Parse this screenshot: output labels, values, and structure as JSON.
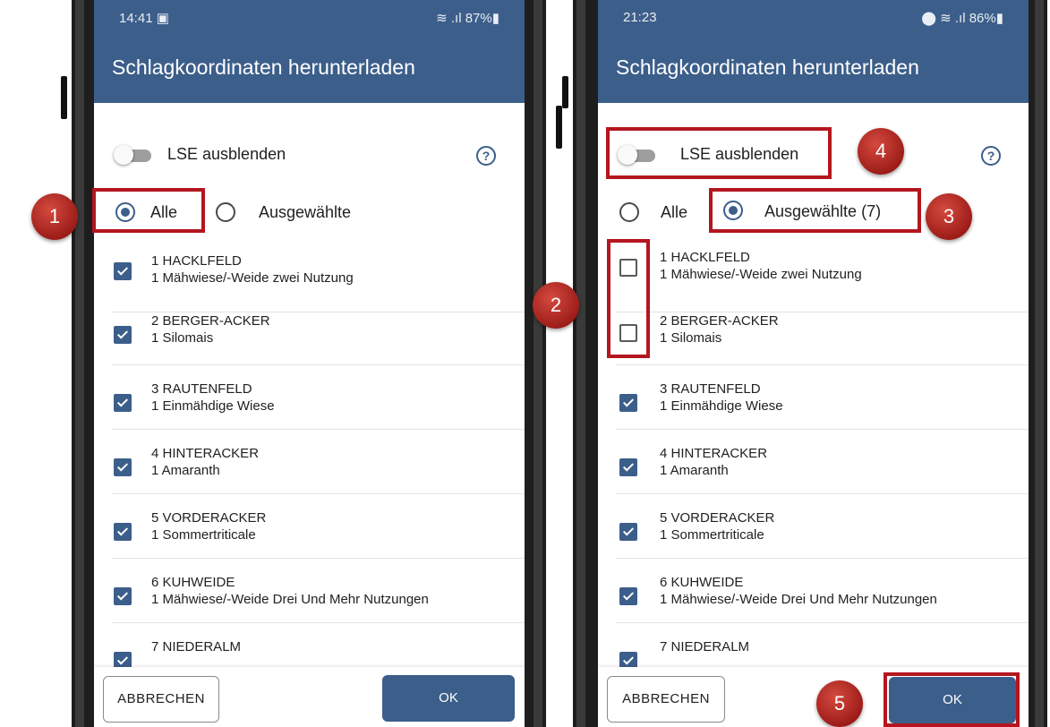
{
  "left_phone": {
    "status": {
      "time": "14:41 ▣",
      "indicators": "≋ .ıl 87%▮"
    },
    "title": "Schlagkoordinaten herunterladen",
    "toggle_label": "LSE ausblenden",
    "help_glyph": "?",
    "radio_all": "Alle",
    "radio_selected": "Ausgewählte",
    "items": [
      {
        "name": "1 HACKLFELD",
        "crop": "1 Mähwiese/-Weide zwei Nutzung"
      },
      {
        "name": "2 BERGER-ACKER",
        "crop": "1 Silomais"
      },
      {
        "name": "3 RAUTENFELD",
        "crop": "1 Einmähdige Wiese"
      },
      {
        "name": "4 HINTERACKER",
        "crop": "1 Amaranth"
      },
      {
        "name": "5 VORDERACKER",
        "crop": "1 Sommertriticale"
      },
      {
        "name": "6 KUHWEIDE",
        "crop": "1 Mähwiese/-Weide Drei Und Mehr Nutzungen"
      },
      {
        "name": "7 NIEDERALM",
        "crop": ""
      }
    ],
    "cancel": "ABBRECHEN",
    "ok": "OK"
  },
  "right_phone": {
    "status": {
      "time": "21:23",
      "indicators": "⬤ ≋ .ıl 86%▮"
    },
    "title": "Schlagkoordinaten herunterladen",
    "toggle_label": "LSE ausblenden",
    "help_glyph": "?",
    "radio_all": "Alle",
    "radio_selected": "Ausgewählte (7)",
    "items": [
      {
        "name": "1 HACKLFELD",
        "crop": "1 Mähwiese/-Weide zwei Nutzung"
      },
      {
        "name": "2 BERGER-ACKER",
        "crop": "1 Silomais"
      },
      {
        "name": "3 RAUTENFELD",
        "crop": "1 Einmähdige Wiese"
      },
      {
        "name": "4 HINTERACKER",
        "crop": "1 Amaranth"
      },
      {
        "name": "5 VORDERACKER",
        "crop": "1 Sommertriticale"
      },
      {
        "name": "6 KUHWEIDE",
        "crop": "1 Mähwiese/-Weide Drei Und Mehr Nutzungen"
      },
      {
        "name": "7 NIEDERALM",
        "crop": ""
      }
    ],
    "cancel": "ABBRECHEN",
    "ok": "OK"
  },
  "badges": {
    "b1": "1",
    "b2": "2",
    "b3": "3",
    "b4": "4",
    "b5": "5"
  },
  "state": {
    "left_radio": "all",
    "right_radio": "selected",
    "left_checked": [
      true,
      true,
      true,
      true,
      true,
      true,
      true
    ],
    "right_checked": [
      false,
      false,
      true,
      true,
      true,
      true,
      true
    ]
  },
  "colors": {
    "primary": "#3c5e8a",
    "highlight": "#b4161f",
    "badge": "#b52a24"
  }
}
